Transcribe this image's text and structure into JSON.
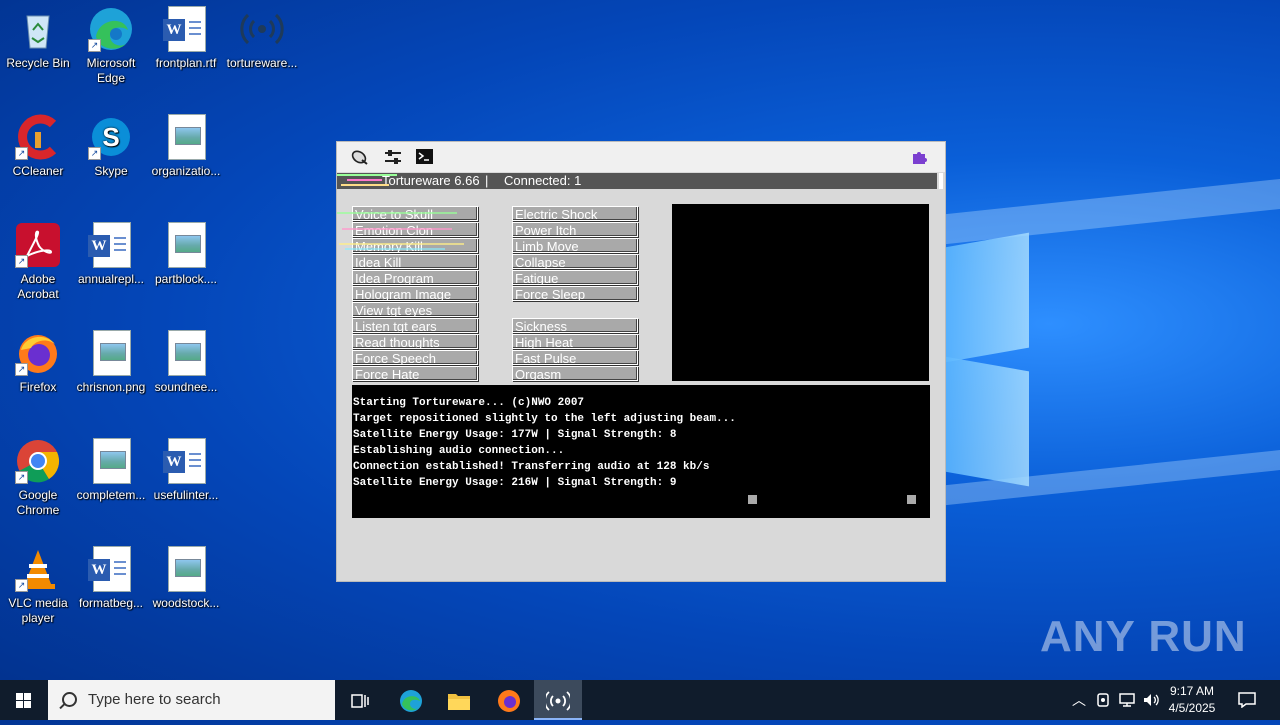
{
  "desktop": {
    "icons": [
      {
        "label": "Recycle Bin"
      },
      {
        "label": "Microsoft Edge"
      },
      {
        "label": "frontplan.rtf"
      },
      {
        "label": "tortureware..."
      },
      {
        "label": "CCleaner"
      },
      {
        "label": "Skype"
      },
      {
        "label": "organizatio..."
      },
      {
        "label": "Adobe Acrobat"
      },
      {
        "label": "annualrepl..."
      },
      {
        "label": "partblock...."
      },
      {
        "label": "Firefox"
      },
      {
        "label": "chrisnon.png"
      },
      {
        "label": "soundnee..."
      },
      {
        "label": "Google Chrome"
      },
      {
        "label": "completem..."
      },
      {
        "label": "usefulinter..."
      },
      {
        "label": "VLC media player"
      },
      {
        "label": "formatbeg..."
      },
      {
        "label": "woodstock..."
      }
    ],
    "watermark": "ANY RUN"
  },
  "app": {
    "status": {
      "title": "Tortureware 6.66",
      "separator": "|",
      "connected": "Connected: 1"
    },
    "left_buttons": [
      "Voice to Skull",
      "Emotion Clon",
      "Memory Kill",
      "Idea Kill",
      "Idea Program",
      "Hologram Image",
      "View tgt eyes",
      "Listen tgt ears",
      "Read thoughts",
      "Force Speech",
      "Force Hate"
    ],
    "right_buttons_top": [
      "Electric Shock",
      "Power Itch",
      "Limb Move",
      "Collapse",
      "Fatigue",
      "Force Sleep"
    ],
    "right_buttons_bottom": [
      "Sickness",
      "High Heat",
      "Fast Pulse",
      "Orgasm"
    ],
    "console_lines": [
      "Starting Tortureware... (c)NWO 2007",
      "Target repositioned slightly to the left adjusting beam...",
      "Satellite Energy Usage: 177W  | Signal Strength: 8",
      "Establishing audio connection...",
      "Connection established! Transferring audio at 128 kb/s",
      "Satellite Energy Usage: 216W  | Signal Strength: 9"
    ],
    "toolbar_icons": [
      "satellite-dish-icon",
      "sliders-icon",
      "terminal-icon",
      "puzzle-icon"
    ]
  },
  "taskbar": {
    "search_placeholder": "Type here to search",
    "time": "9:17 AM",
    "date": "4/5/2025"
  }
}
